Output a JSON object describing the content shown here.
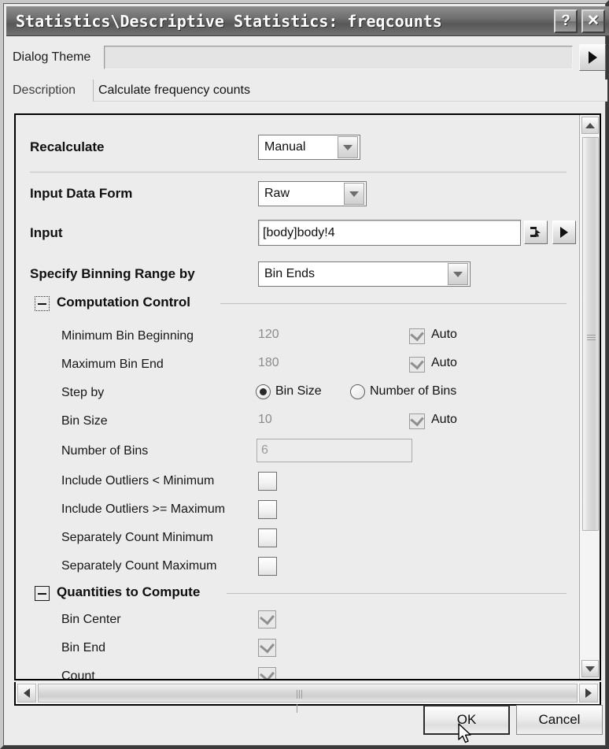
{
  "window": {
    "title": "Statistics\\Descriptive Statistics: freqcounts",
    "help_button": "?",
    "close_button": "✕"
  },
  "theme": {
    "label": "Dialog Theme",
    "value": "",
    "placeholder": "",
    "arrow_button": "theme-arrow"
  },
  "description": {
    "label": "Description",
    "value": "Calculate frequency counts"
  },
  "form": {
    "recalculate": {
      "label": "Recalculate",
      "value": "Manual"
    },
    "input_data_form": {
      "label": "Input Data Form",
      "value": "Raw"
    },
    "input": {
      "label": "Input",
      "value": "[body]body!4"
    },
    "specify_binning_range_by": {
      "label": "Specify Binning Range by",
      "value": "Bin Ends"
    }
  },
  "computation_control": {
    "title": "Computation Control",
    "rows": [
      {
        "label": "Minimum Bin Beginning",
        "value": "120",
        "auto_label": "Auto",
        "auto_checked": true
      },
      {
        "label": "Maximum Bin End",
        "value": "180",
        "auto_label": "Auto",
        "auto_checked": true
      }
    ],
    "step_by": {
      "label": "Step by",
      "options": [
        "Bin Size",
        "Number of Bins"
      ],
      "selected": "Bin Size"
    },
    "bin_size": {
      "label": "Bin Size",
      "value": "10",
      "auto_label": "Auto",
      "auto_checked": true
    },
    "number_of_bins": {
      "label": "Number of Bins",
      "value": "6",
      "disabled": true
    },
    "checkboxes": [
      {
        "label": "Include Outliers < Minimum",
        "checked": false
      },
      {
        "label": "Include Outliers >= Maximum",
        "checked": false
      },
      {
        "label": "Separately Count Minimum",
        "checked": false
      },
      {
        "label": "Separately Count Maximum",
        "checked": false
      }
    ]
  },
  "quantities_to_compute": {
    "title": "Quantities to Compute",
    "items": [
      {
        "label": "Bin Center",
        "checked": true
      },
      {
        "label": "Bin End",
        "checked": true
      },
      {
        "label": "Count",
        "checked": true
      }
    ]
  },
  "buttons": {
    "ok": "OK",
    "cancel": "Cancel"
  },
  "colors": {
    "dialog_background": "#ececec",
    "titlebar": "#6f6f6f",
    "title_text": "#ffffff",
    "panel_border": "#000000",
    "disabled_text": "#8c8c8c"
  }
}
